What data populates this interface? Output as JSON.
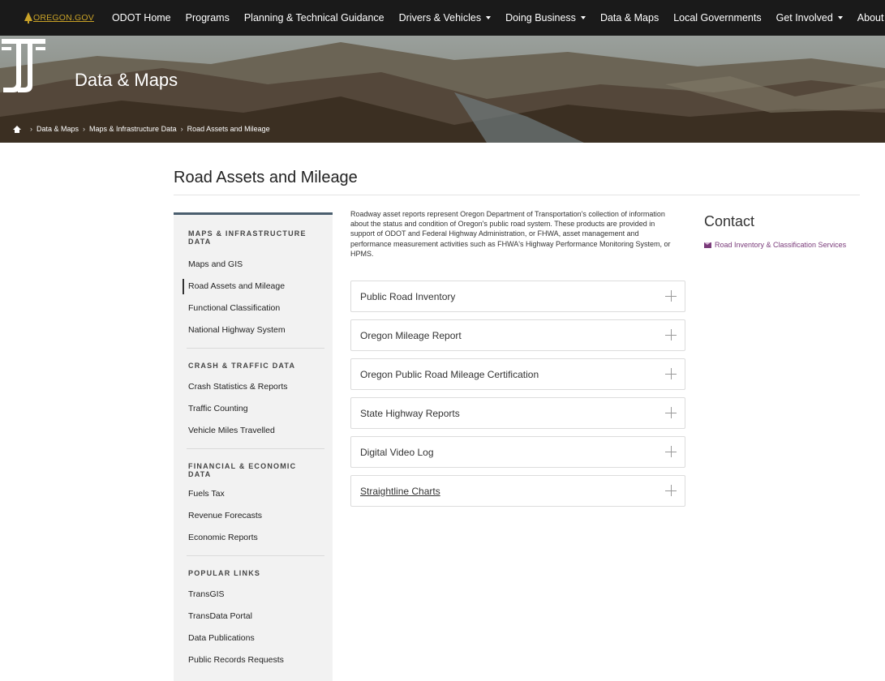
{
  "topnav": {
    "logo_text": "OREGON.GOV",
    "items": [
      {
        "label": "ODOT Home",
        "has_caret": false
      },
      {
        "label": "Programs",
        "has_caret": false
      },
      {
        "label": "Planning & Technical Guidance",
        "has_caret": false
      },
      {
        "label": "Drivers & Vehicles",
        "has_caret": true
      },
      {
        "label": "Doing Business",
        "has_caret": true
      },
      {
        "label": "Data & Maps",
        "has_caret": false
      },
      {
        "label": "Local Governments",
        "has_caret": false
      },
      {
        "label": "Get Involved",
        "has_caret": true
      },
      {
        "label": "About Us",
        "has_caret": true
      }
    ]
  },
  "hero": {
    "title": "Data & Maps",
    "breadcrumb": [
      "Data & Maps",
      "Maps & Infrastructure Data",
      "Road Assets and Mileage"
    ]
  },
  "page": {
    "title": "Road Assets and Mileage",
    "intro": "Roadway asset reports represent Oregon Department of Transportation's collection of information about the status and condition of Oregon's public road system. These products are provided in support of ODOT and Federal Highway Administration, or FHWA, asset management and performance measurement activities such as FHWA's Highway Performance Monitoring System, or HPMS."
  },
  "sidebar": {
    "sections": [
      {
        "heading": "MAPS & INFRASTRUCTURE DATA",
        "items": [
          "Maps and GIS",
          "Road Assets and Mileage",
          "Functional Classification",
          "National Highway System"
        ],
        "active": "Road Assets and Mileage"
      },
      {
        "heading": "CRASH & TRAFFIC DATA",
        "items": [
          "Crash Statistics & Reports",
          "Traffic Counting",
          "Vehicle Miles Travelled"
        ]
      },
      {
        "heading": "FINANCIAL & ECONOMIC DATA",
        "items": [
          "Fuels Tax",
          "Revenue Forecasts",
          "Economic Reports"
        ]
      },
      {
        "heading": "POPULAR LINKS",
        "items": [
          "TransGIS",
          "TransData Portal",
          "Data Publications",
          "Public Records Requests"
        ]
      }
    ]
  },
  "accordions": [
    {
      "label": "Public Road Inventory",
      "underlined": false
    },
    {
      "label": "Oregon Mileage Report",
      "underlined": false
    },
    {
      "label": "Oregon Public Road Mileage Certification",
      "underlined": false
    },
    {
      "label": "State Highway Reports",
      "underlined": false
    },
    {
      "label": "Digital Video Log",
      "underlined": false
    },
    {
      "label": "Straightline Charts",
      "underlined": true
    }
  ],
  "contact": {
    "title": "Contact",
    "link_text": "Road Inventory & Classification Services"
  },
  "colors": {
    "topnav_bg": "#1a1a1a",
    "logo_gold": "#c9a227",
    "sidebar_bg": "#f2f2f2",
    "sidebar_border": "#4a5e6e",
    "contact_link": "#7a3b7a"
  }
}
